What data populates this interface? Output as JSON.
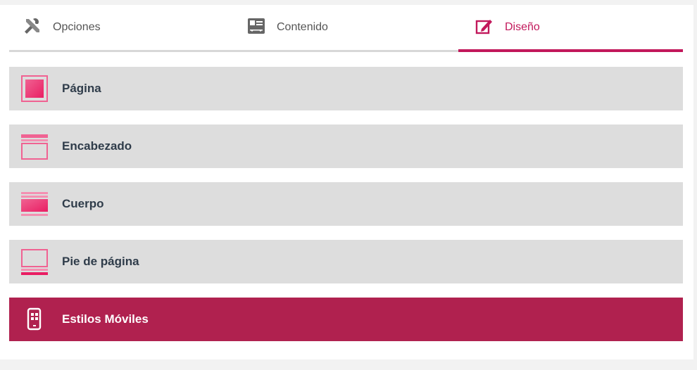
{
  "tabs": [
    {
      "label": "Opciones",
      "icon": "tools-icon"
    },
    {
      "label": "Contenido",
      "icon": "contact-card-icon"
    },
    {
      "label": "Diseño",
      "icon": "edit-icon",
      "active": true
    }
  ],
  "sections": [
    {
      "label": "Página",
      "icon": "page-layout-icon"
    },
    {
      "label": "Encabezado",
      "icon": "header-layout-icon"
    },
    {
      "label": "Cuerpo",
      "icon": "body-layout-icon"
    },
    {
      "label": "Pie de página",
      "icon": "footer-layout-icon"
    },
    {
      "label": "Estilos Móviles",
      "icon": "mobile-icon",
      "active": true
    }
  ],
  "colors": {
    "accent": "#c2185b",
    "active_bar": "#b0214f",
    "section_bg": "#dddddd",
    "label_text": "#2f3c4a"
  }
}
